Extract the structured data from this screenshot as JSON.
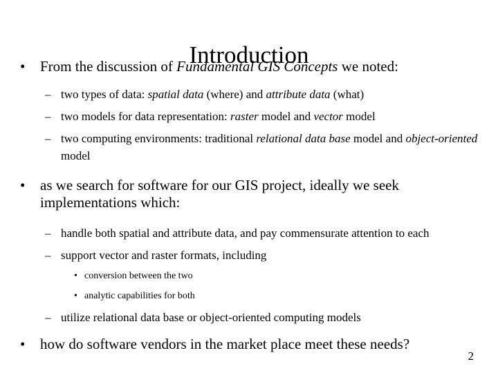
{
  "slide": {
    "title": "Introduction",
    "number": "2",
    "background_color": "#ffffff",
    "text_color": "#000000",
    "bullet_glyphs": {
      "level1": "•",
      "level2": "–",
      "level3": "•"
    },
    "blocks": [
      {
        "level": 1,
        "name": "bullet-from-the-discussion",
        "runs": [
          {
            "text": "From the discussion of ",
            "italic": false
          },
          {
            "text": "Fundamental GIS Concepts",
            "italic": true
          },
          {
            "text": " we noted:",
            "italic": false
          }
        ]
      },
      {
        "level": 2,
        "name": "bullet-two-types-of-data",
        "runs": [
          {
            "text": "two types of data: ",
            "italic": false
          },
          {
            "text": "spatial data",
            "italic": true
          },
          {
            "text": " (where) and ",
            "italic": false
          },
          {
            "text": "attribute data",
            "italic": true
          },
          {
            "text": " (what)",
            "italic": false
          }
        ]
      },
      {
        "level": 2,
        "name": "bullet-two-models-for-data-representation",
        "runs": [
          {
            "text": "two models for data representation: ",
            "italic": false
          },
          {
            "text": "raster",
            "italic": true
          },
          {
            "text": " model and ",
            "italic": false
          },
          {
            "text": "vector",
            "italic": true
          },
          {
            "text": " model",
            "italic": false
          }
        ]
      },
      {
        "level": 2,
        "name": "bullet-two-computing-environments",
        "runs": [
          {
            "text": "two computing environments: traditional ",
            "italic": false
          },
          {
            "text": "relational data base",
            "italic": true
          },
          {
            "text": " model and ",
            "italic": false
          },
          {
            "text": "object-oriented",
            "italic": true
          },
          {
            "text": " model",
            "italic": false
          }
        ]
      },
      {
        "level": 1,
        "name": "bullet-as-we-search-for-software",
        "runs": [
          {
            "text": "as we search for software for our GIS project, ideally we seek implementations which:",
            "italic": false
          }
        ]
      },
      {
        "level": 2,
        "name": "bullet-handle-both-spatial-and-attribute-data",
        "runs": [
          {
            "text": "handle both spatial and attribute data, and pay commensurate attention to each",
            "italic": false
          }
        ]
      },
      {
        "level": 2,
        "name": "bullet-support-vector-and-raster-formats",
        "runs": [
          {
            "text": "support vector and raster formats, including",
            "italic": false
          }
        ]
      },
      {
        "level": 3,
        "name": "bullet-conversion-between-the-two",
        "runs": [
          {
            "text": "conversion between the two",
            "italic": false
          }
        ]
      },
      {
        "level": 3,
        "name": "bullet-analytic-capabilities-for-both",
        "runs": [
          {
            "text": "analytic capabilities for both",
            "italic": false
          }
        ]
      },
      {
        "level": 2,
        "name": "bullet-utilize-relational-data-base",
        "runs": [
          {
            "text": "utilize relational data base or object-oriented computing models",
            "italic": false
          }
        ]
      },
      {
        "level": 1,
        "name": "bullet-how-do-software-vendors",
        "runs": [
          {
            "text": "how do software vendors in the market place meet these needs?",
            "italic": false
          }
        ]
      }
    ],
    "spacing_after": [
      "gap-md",
      "gap-sm",
      "gap-sm",
      "gap-lg",
      "gap-lg",
      "gap-sm",
      "gap-sm",
      "gap-sm",
      "gap-sm",
      "gap-md",
      ""
    ]
  }
}
